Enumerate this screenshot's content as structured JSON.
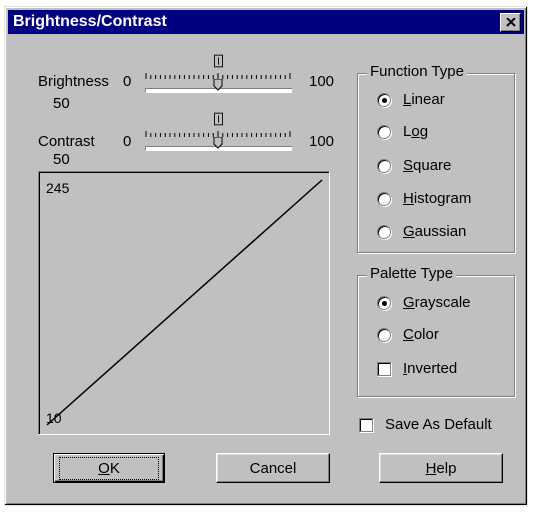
{
  "window": {
    "title": "Brightness/Contrast",
    "close_label": "×"
  },
  "brightness": {
    "label": "Brightness",
    "min": "0",
    "max": "100",
    "value": "50",
    "level": 0.5
  },
  "contrast": {
    "label": "Contrast",
    "min": "0",
    "max": "100",
    "value": "50",
    "level": 0.5
  },
  "plot": {
    "top_label": "245",
    "bottom_label": "10"
  },
  "function_type": {
    "title": "Function Type",
    "options": [
      {
        "key": "L",
        "rest": "inear",
        "selected": true
      },
      {
        "key": "o",
        "pre": "L",
        "rest": "g",
        "selected": false
      },
      {
        "key": "S",
        "rest": "quare",
        "selected": false
      },
      {
        "key": "H",
        "rest": "istogram",
        "selected": false
      },
      {
        "key": "G",
        "rest": "aussian",
        "selected": false
      }
    ]
  },
  "palette_type": {
    "title": "Palette Type",
    "options": [
      {
        "key": "G",
        "rest": "rayscale",
        "selected": true
      },
      {
        "key": "C",
        "rest": "olor",
        "selected": false
      }
    ],
    "inverted": {
      "key": "I",
      "rest": "nverted",
      "checked": false
    }
  },
  "save_default": {
    "label": "Save As Default",
    "checked": false
  },
  "buttons": {
    "ok_key": "O",
    "ok_rest": "K",
    "cancel": "Cancel",
    "help_key": "H",
    "help_rest": "elp"
  }
}
